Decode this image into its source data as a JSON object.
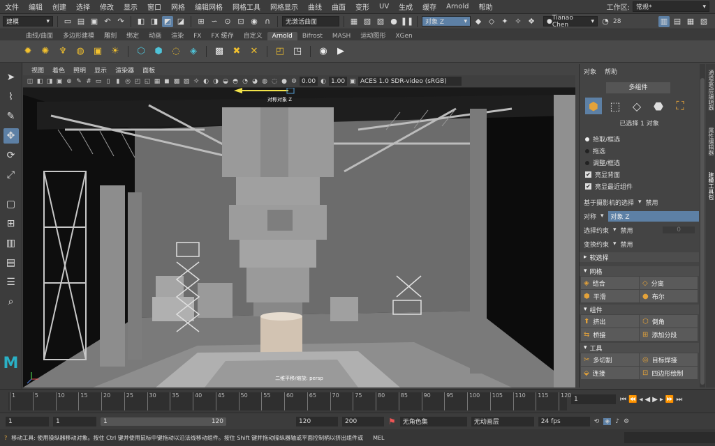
{
  "menubar": {
    "items": [
      "文件",
      "编辑",
      "创建",
      "选择",
      "修改",
      "显示",
      "窗口",
      "网格",
      "编辑网格",
      "网格工具",
      "网格显示",
      "曲线",
      "曲面",
      "变形",
      "UV",
      "生成",
      "缓存",
      "Arnold",
      "帮助"
    ],
    "workspace_label": "工作区:",
    "workspace_value": "常规*"
  },
  "statusline": {
    "mode": "建模",
    "live_surface": "无激活曲面",
    "symmetry": "对象 Z",
    "user": "Tianao Chen",
    "notifications": "28"
  },
  "shelf": {
    "tabs": [
      "曲线/曲面",
      "多边形建模",
      "雕刻",
      "绑定",
      "动画",
      "渲染",
      "FX",
      "FX 缓存",
      "自定义",
      "Arnold",
      "Bifrost",
      "MASH",
      "运动图形",
      "XGen"
    ],
    "active_tab": "Arnold"
  },
  "viewport": {
    "menus": [
      "视图",
      "着色",
      "照明",
      "显示",
      "渲染器",
      "面板"
    ],
    "exposure": "0.00",
    "gamma": "1.00",
    "color_space": "ACES 1.0 SDR-video (sRGB)",
    "symmetry_label": "对称对象 Z",
    "camera_label": "二维平移/缩放: persp"
  },
  "toolpanel": {
    "menus": [
      "对象",
      "帮助"
    ],
    "subheader": "多组件",
    "selection_count": "已选择 1 对象",
    "options": [
      {
        "label": "拾取/框选",
        "type": "radio",
        "on": true
      },
      {
        "label": "拖选",
        "type": "radio",
        "on": false
      },
      {
        "label": "调整/框选",
        "type": "radio",
        "on": false
      },
      {
        "label": "亮显背面",
        "type": "check",
        "on": true
      },
      {
        "label": "亮显最近组件",
        "type": "check",
        "on": true
      }
    ],
    "camera_select_label": "基于摄影机的选择",
    "camera_select_value": "禁用",
    "symmetry_label": "对称",
    "symmetry_value": "对象 Z",
    "sel_constraint_label": "选择约束",
    "sel_constraint_value": "禁用",
    "sel_constraint_num": "0",
    "xform_constraint_label": "变换约束",
    "xform_constraint_value": "禁用",
    "soft_select": "软选择",
    "sections": [
      {
        "title": "网格",
        "buttons": [
          "结合",
          "分离",
          "平滑",
          "布尔"
        ]
      },
      {
        "title": "组件",
        "buttons": [
          "挤出",
          "倒角",
          "桥接",
          "添加分段"
        ]
      },
      {
        "title": "工具",
        "buttons": [
          "多切割",
          "目标焊接",
          "连接",
          "四边形绘制"
        ]
      }
    ],
    "side_tabs": [
      "通道盒/层编辑器",
      "属性编辑器",
      "建模工具包"
    ]
  },
  "timeline": {
    "ticks": [
      "1",
      "5",
      "10",
      "15",
      "20",
      "25",
      "30",
      "35",
      "40",
      "45",
      "50",
      "55",
      "60",
      "65",
      "70",
      "75",
      "80",
      "85",
      "90",
      "95",
      "100",
      "105",
      "110",
      "115",
      "120"
    ],
    "current_frame": "1"
  },
  "range": {
    "start": "1",
    "playback_start": "1",
    "range_start_inner": "1",
    "range_end_inner": "120",
    "playback_end": "120",
    "end": "200",
    "char_set": "无角色集",
    "anim_layer": "无动画层",
    "fps": "24 fps"
  },
  "helpline": {
    "text": "移动工具: 使用操纵器移动对象。按住 Ctrl 键并使用鼠标中键拖动以沿法线移动组件。按住 Shift 键并拖动操纵器轴或平面控制柄以挤出组件或",
    "mel": "MEL"
  }
}
